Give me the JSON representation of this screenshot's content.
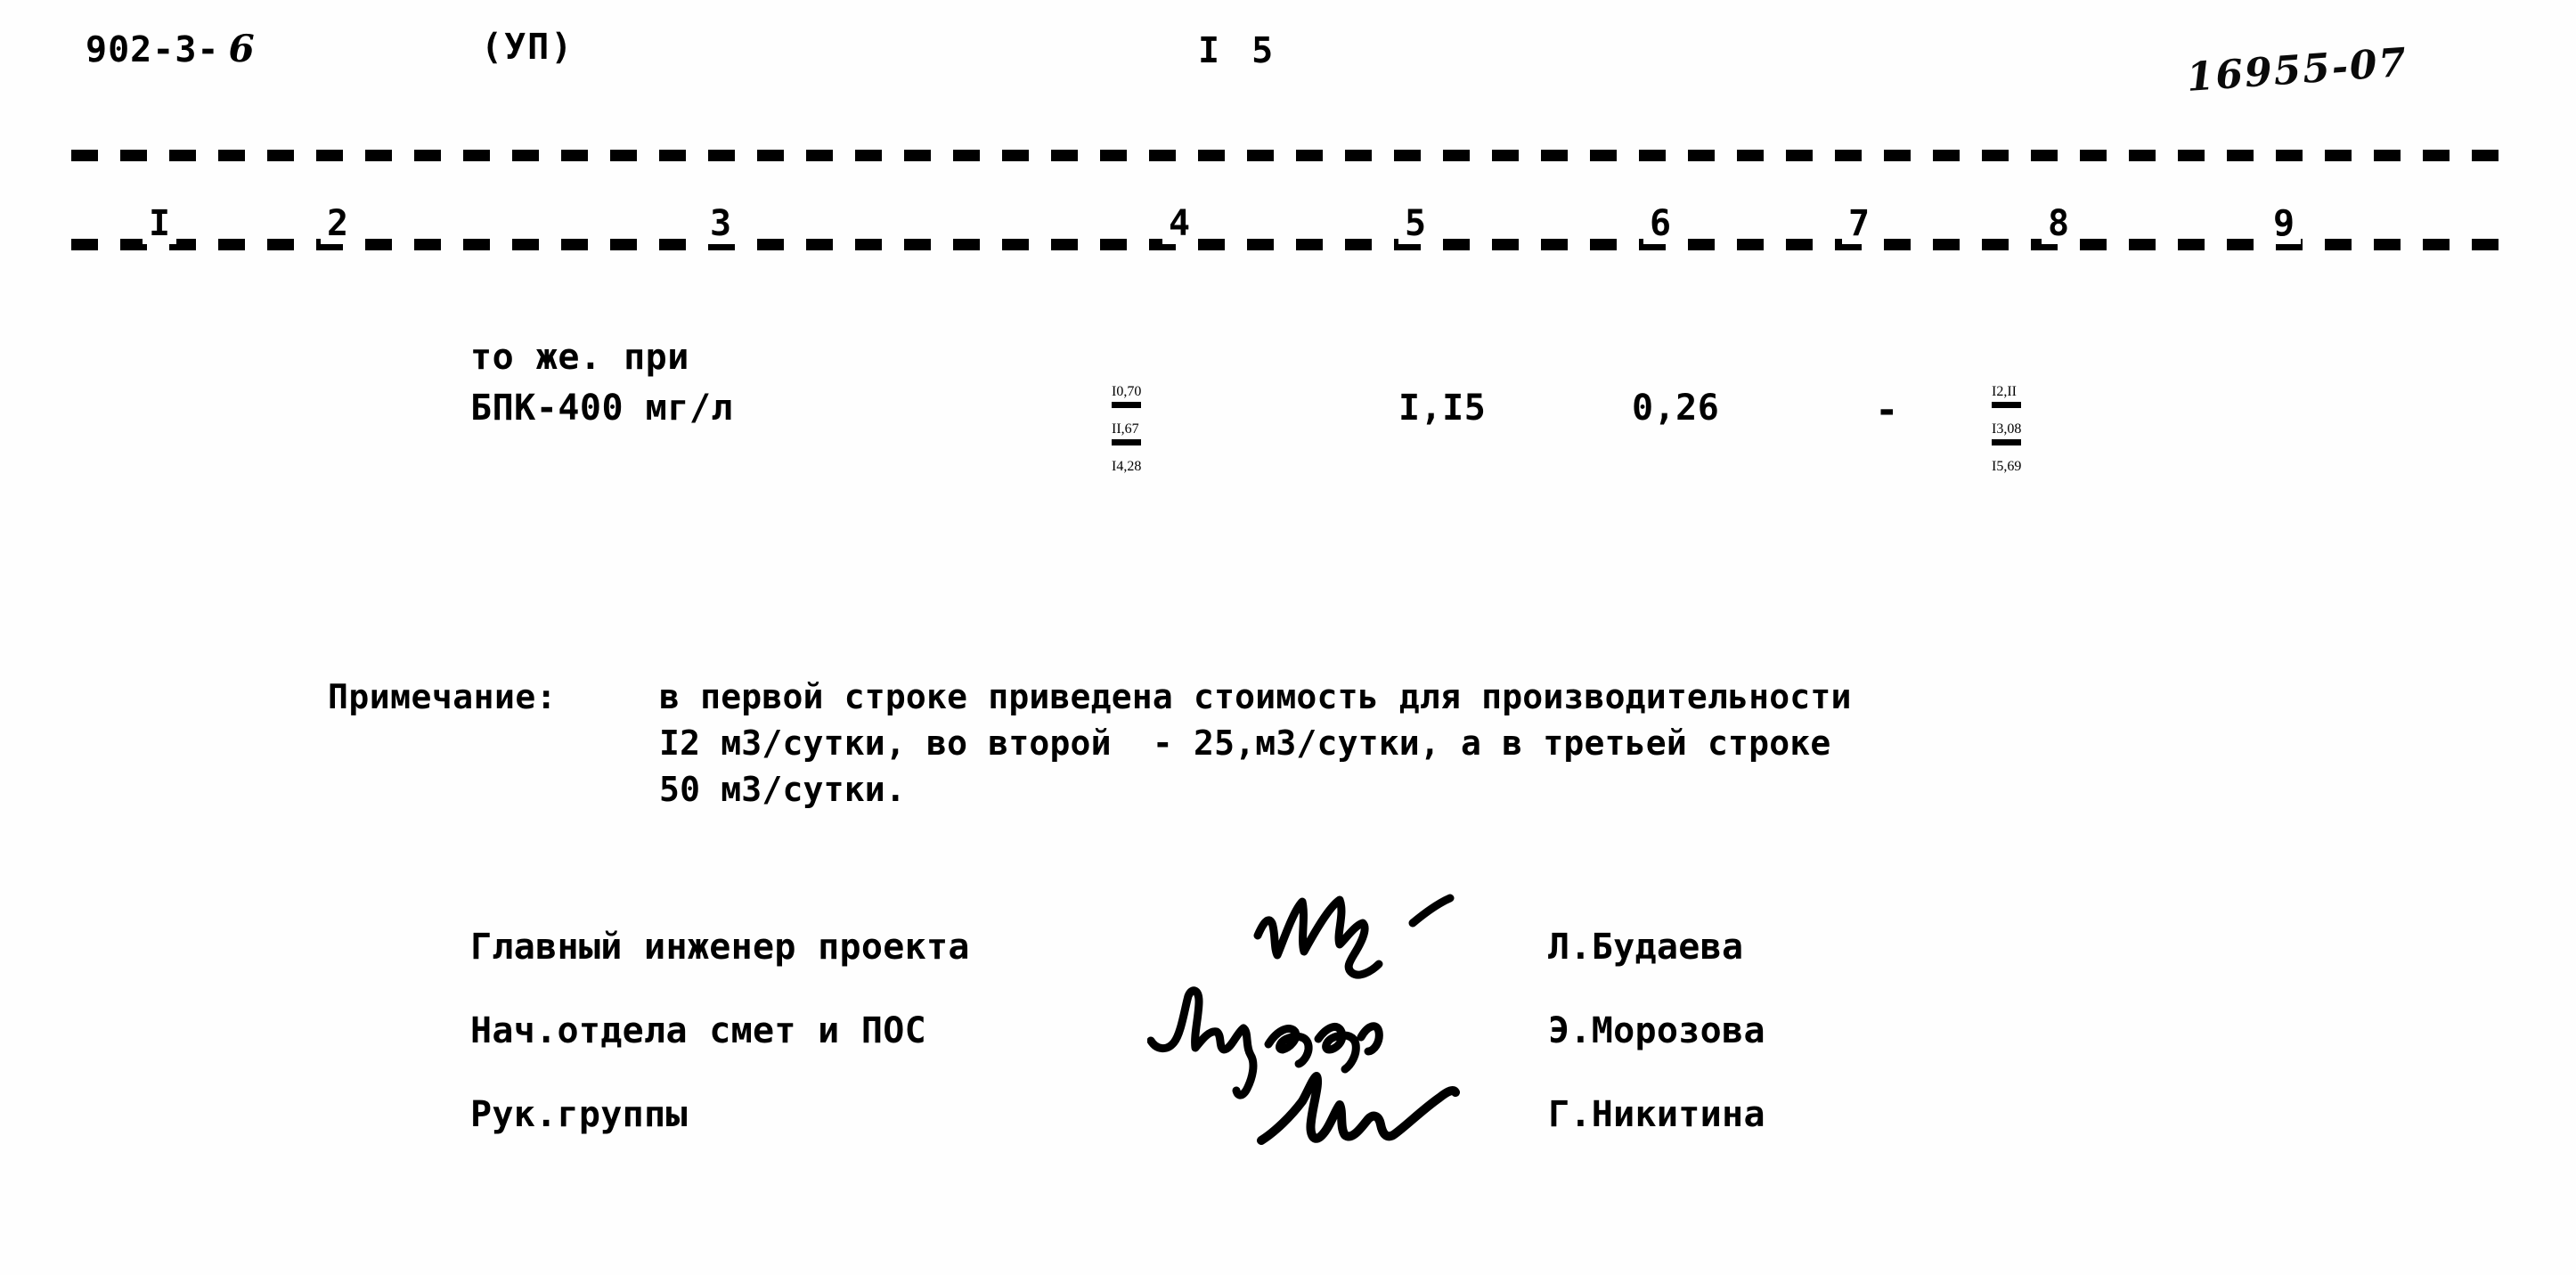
{
  "header": {
    "doc_code": "902-3-",
    "doc_code_suffix": "6",
    "album_mark": "(УП)",
    "page_number": "I 5",
    "archive_code": "16955-07"
  },
  "table": {
    "column_numbers": [
      "I",
      "2",
      "3",
      "4",
      "5",
      "6",
      "7",
      "8",
      "9"
    ],
    "row": {
      "description_line1": "то же. при",
      "description_line2": "БПК-400 мг/л",
      "col4": [
        "I0,70",
        "II,67",
        "I4,28"
      ],
      "col5": "I,I5",
      "col6": "0,26",
      "col7": "-",
      "col8": [
        "I2,II",
        "I3,08",
        "I5,69"
      ]
    }
  },
  "note": {
    "label": "Примечание:",
    "line1": "в первой строке приведена стоимость для производительности",
    "line2": "I2 м3/сутки, во второй  - 25,м3/сутки, а в третьей строке",
    "line3": "50 м3/сутки."
  },
  "signatures": [
    {
      "title": "Главный инженер проекта",
      "name": "Л.Будаева"
    },
    {
      "title": "Нач.отдела смет и ПОС",
      "name": "Э.Морозова"
    },
    {
      "title": "Рук.группы",
      "name": "Г.Никитина"
    }
  ],
  "colors": {
    "ink": "#000000",
    "paper": "#fefefe"
  }
}
